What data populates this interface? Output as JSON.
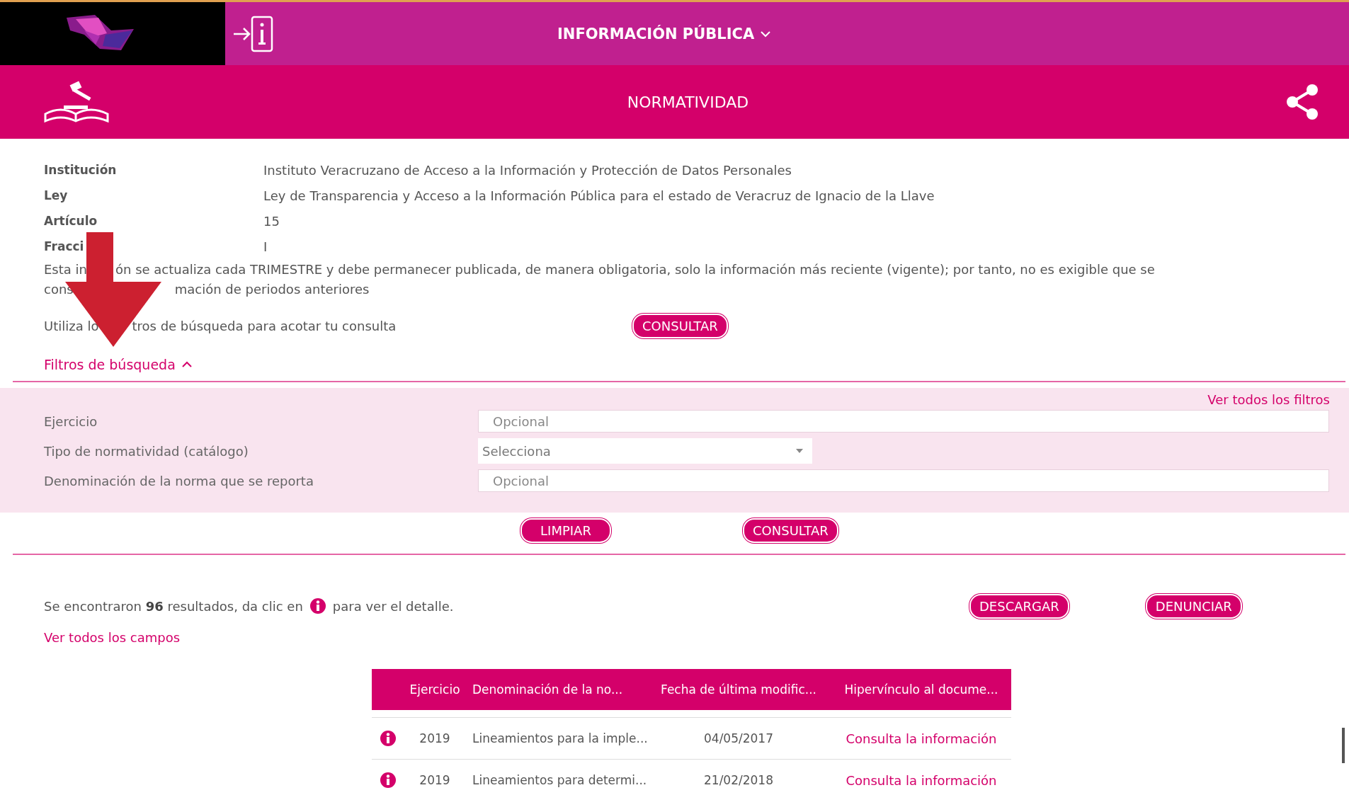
{
  "header": {
    "title": "INFORMACIÓN PÚBLICA"
  },
  "section": {
    "title": "NORMATIVIDAD"
  },
  "details": [
    {
      "label": "Institución",
      "value": "Instituto Veracruzano de Acceso a la Información y Protección de Datos Personales"
    },
    {
      "label": "Ley",
      "value": "Ley de Transparencia y Acceso a la Información Pública para el estado de Veracruz de Ignacio de la Llave"
    },
    {
      "label": "Artículo",
      "value": "15"
    },
    {
      "label": "Fracci",
      "value": "I"
    }
  ],
  "notice_lines": [
    {
      "parts": [
        "Esta in",
        "ón se actualiza cada TRIMESTRE y debe permanecer publicada, de manera obligatoria, solo la información más reciente (vigente); por tanto, no es exigible que se"
      ]
    },
    {
      "parts": [
        "cons",
        "mación de periodos anteriores"
      ]
    }
  ],
  "hint": {
    "parts": [
      "Utiliza lo",
      "tros de búsqueda para acotar tu consulta"
    ],
    "button": "CONSULTAR"
  },
  "filters_toggle": {
    "label": "Filtros de búsqueda",
    "expanded": true
  },
  "filters": {
    "view_all": "Ver todos los filtros",
    "fields": [
      {
        "label": "Ejercicio",
        "kind": "text",
        "placeholder": "Opcional"
      },
      {
        "label": "Tipo de normatividad (catálogo)",
        "kind": "select",
        "value": "Selecciona"
      },
      {
        "label": "Denominación de la norma que se reporta",
        "kind": "text",
        "placeholder": "Opcional"
      }
    ]
  },
  "filter_buttons": [
    "LIMPIAR",
    "CONSULTAR"
  ],
  "results": {
    "summary": "Se encontraron **96** resultados, da clic en",
    "summary_end": "para ver el detalle.",
    "buttons": [
      "DESCARGAR",
      "DENUNCIAR"
    ],
    "view_all_fields": "Ver todos los campos"
  },
  "table": {
    "columns": [
      "Ejercicio",
      "Denominación de la no...",
      "Fecha de última modific...",
      "Hipervínculo al docume..."
    ],
    "rows": [
      {
        "cells": [
          "2019",
          "Lineamientos para la imple...",
          "04/05/2017",
          "Consulta la información"
        ]
      },
      {
        "cells": [
          "2019",
          "Lineamientos para determi...",
          "21/02/2018",
          "Consulta la información"
        ]
      }
    ]
  }
}
